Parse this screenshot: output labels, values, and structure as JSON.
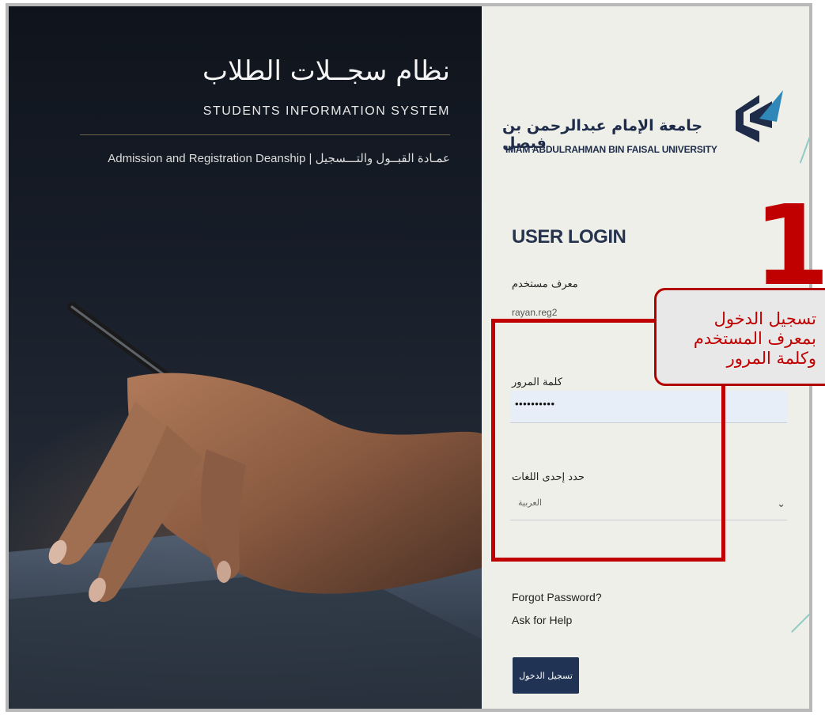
{
  "hero": {
    "title_ar": "نظام سجــلات الطلاب",
    "title_en": "STUDENTS INFORMATION SYSTEM",
    "subtitle": "Admission and Registration Deanship | عمـادة القبــول والتـــسجيل"
  },
  "university": {
    "name_ar": "جامعة الإمام عبدالرحمن بن فيصل",
    "name_en": "IMAM ABDULRAHMAN BIN FAISAL UNIVERSITY",
    "logo_icon": "university-logo-icon"
  },
  "login": {
    "title": "USER LOGIN",
    "username_label": "معرف مستخدم",
    "username_value": "rayan.reg2",
    "password_label": "كلمة المرور",
    "password_value": "••••••••••",
    "language_label": "حدد إحدى اللغات",
    "language_selected": "العربية",
    "forgot_password": "Forgot Password?",
    "ask_help": "Ask for Help",
    "submit": "تسجيل الدخول"
  },
  "annotation": {
    "step": "1",
    "callout_line1": "تسجيل الدخول",
    "callout_line2": "بمعرف المستخدم",
    "callout_line3": "وكلمة المرور",
    "highlight_color": "#c00000"
  },
  "colors": {
    "brand_navy": "#203354",
    "panel_bg": "#efefe9",
    "accent_red": "#c00000"
  }
}
